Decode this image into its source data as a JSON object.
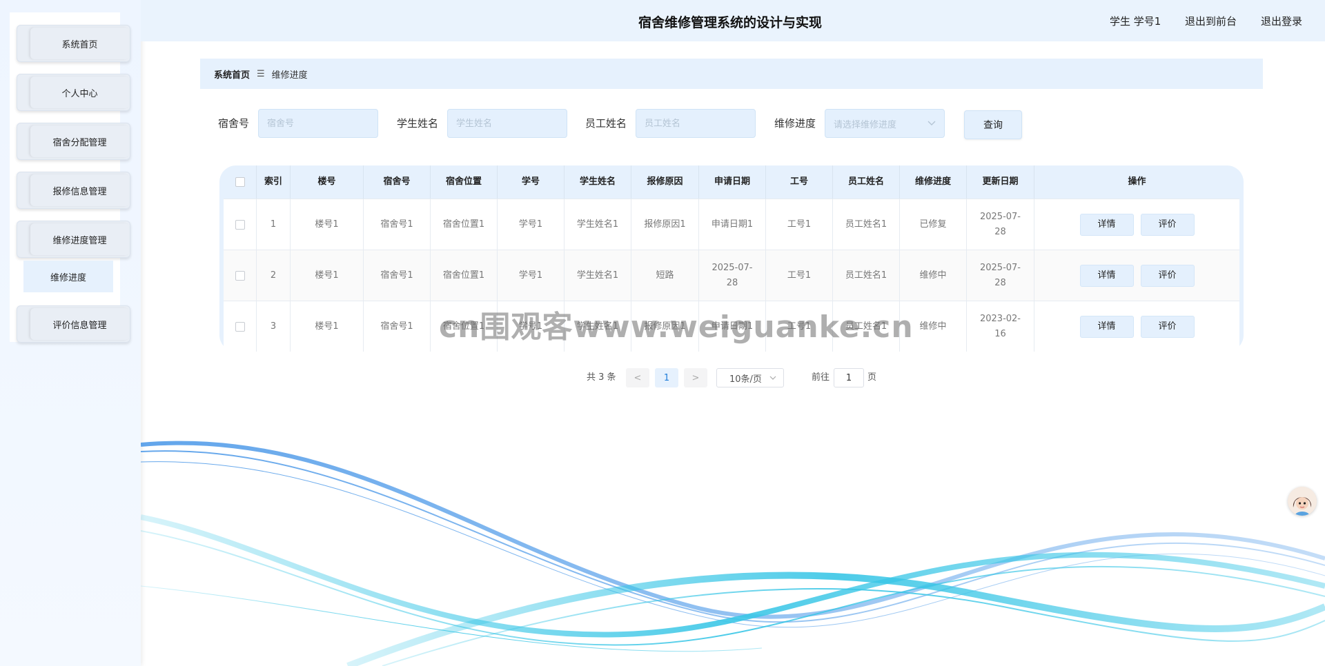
{
  "header": {
    "title": "宿舍维修管理系统的设计与实现",
    "user": "学生 学号1",
    "back_to_front": "退出到前台",
    "logout": "退出登录"
  },
  "sidebar": {
    "items": [
      {
        "label": "系统首页"
      },
      {
        "label": "个人中心"
      },
      {
        "label": "宿舍分配管理"
      },
      {
        "label": "报修信息管理"
      },
      {
        "label": "维修进度管理"
      },
      {
        "label": "评价信息管理"
      }
    ],
    "submenu": {
      "label": "维修进度"
    }
  },
  "breadcrumb": {
    "home": "系统首页",
    "separator": "☰",
    "current": "维修进度"
  },
  "search": {
    "dorm_label": "宿舍号",
    "dorm_placeholder": "宿舍号",
    "student_label": "学生姓名",
    "student_placeholder": "学生姓名",
    "staff_label": "员工姓名",
    "staff_placeholder": "员工姓名",
    "progress_label": "维修进度",
    "progress_placeholder": "请选择维修进度",
    "query_button": "查询"
  },
  "table": {
    "headers": [
      "索引",
      "楼号",
      "宿舍号",
      "宿舍位置",
      "学号",
      "学生姓名",
      "报修原因",
      "申请日期",
      "工号",
      "员工姓名",
      "维修进度",
      "更新日期",
      "操作"
    ],
    "rows": [
      [
        "1",
        "楼号1",
        "宿舍号1",
        "宿舍位置1",
        "学号1",
        "学生姓名1",
        "报修原因1",
        "申请日期1",
        "工号1",
        "员工姓名1",
        "已修复",
        "2025-07-28"
      ],
      [
        "2",
        "楼号1",
        "宿舍号1",
        "宿舍位置1",
        "学号1",
        "学生姓名1",
        "短路",
        "2025-07-28",
        "工号1",
        "员工姓名1",
        "维修中",
        "2025-07-28"
      ],
      [
        "3",
        "楼号1",
        "宿舍号1",
        "宿舍位置1",
        "学号1",
        "学生姓名1",
        "报修原因1",
        "申请日期1",
        "工号1",
        "员工姓名1",
        "维修中",
        "2023-02-16"
      ]
    ],
    "detail_button": "详情",
    "rate_button": "评价"
  },
  "pagination": {
    "total": "共 3 条",
    "prev": "<",
    "page": "1",
    "next": ">",
    "page_size": "10条/页",
    "goto_label": "前往",
    "goto_value": "1",
    "page_unit": "页"
  },
  "watermark": "cn围观客www.weiguanke.cn",
  "icons": {
    "breadcrumb": "menu-icon",
    "select": "chevron-down-icon",
    "assistant": "avatar-icon"
  },
  "colors": {
    "accent": "#e6f1fd",
    "wave_blue": "#3b8fe6",
    "wave_cyan": "#39c6e6"
  }
}
